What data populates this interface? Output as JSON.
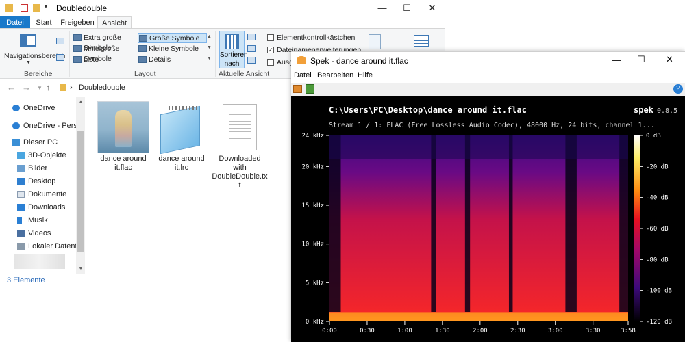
{
  "explorer": {
    "title": "Doubledouble",
    "tabs": [
      "Datei",
      "Start",
      "Freigeben",
      "Ansicht"
    ],
    "ribbon": {
      "nav_pane_label": "Navigationsbereich",
      "group_bereiche": "Bereiche",
      "layout_items": [
        "Extra große Symbole",
        "Große Symbole",
        "Mittelgroße Symbole",
        "Kleine Symbole",
        "Liste",
        "Details"
      ],
      "group_layout": "Layout",
      "sort_label_1": "Sortieren",
      "sort_label_2": "nach",
      "group_view": "Aktuelle Ansicht",
      "checkbox_items": "Elementkontrollkästchen",
      "checkbox_ext": "Dateinamenerweiterungen",
      "checkbox_hidden": "Ausge"
    },
    "breadcrumb": "Doubledouble",
    "nav_items": [
      "OneDrive",
      "OneDrive - Person",
      "Dieser PC",
      "3D-Objekte",
      "Bilder",
      "Desktop",
      "Dokumente",
      "Downloads",
      "Musik",
      "Videos",
      "Lokaler Datenträ"
    ],
    "files": [
      {
        "name_1": "dance around",
        "name_2": "it.flac"
      },
      {
        "name_1": "dance around",
        "name_2": "it.lrc"
      },
      {
        "name_1": "Downloaded",
        "name_2": "with",
        "name_3": "DoubleDouble.tx",
        "name_4": "t"
      }
    ],
    "status": "3 Elemente"
  },
  "spek": {
    "title": "Spek - dance around it.flac",
    "menu": [
      "Datei",
      "Bearbeiten",
      "Hilfe"
    ],
    "path": "C:\\Users\\PC\\Desktop\\dance around it.flac",
    "app_name": "spek",
    "version": "0.8.5",
    "stream_info": "Stream 1 / 1: FLAC (Free Lossless Audio Codec), 48000 Hz, 24 bits, channel 1...",
    "freq_ticks": [
      "24 kHz",
      "20 kHz",
      "15 kHz",
      "10 kHz",
      "5 kHz",
      "0 kHz"
    ],
    "freq_values": [
      24,
      20,
      15,
      10,
      5,
      0
    ],
    "time_ticks": [
      "0:00",
      "0:30",
      "1:00",
      "1:30",
      "2:00",
      "2:30",
      "3:00",
      "3:30",
      "3:58"
    ],
    "time_values": [
      0,
      30,
      60,
      90,
      120,
      150,
      180,
      210,
      238
    ],
    "db_ticks": [
      "0 dB",
      "-20 dB",
      "-40 dB",
      "-60 dB",
      "-80 dB",
      "-100 dB",
      "-120 dB"
    ],
    "db_values": [
      0,
      -20,
      -40,
      -60,
      -80,
      -100,
      -120
    ],
    "duration_s": 238,
    "max_freq_khz": 24
  }
}
